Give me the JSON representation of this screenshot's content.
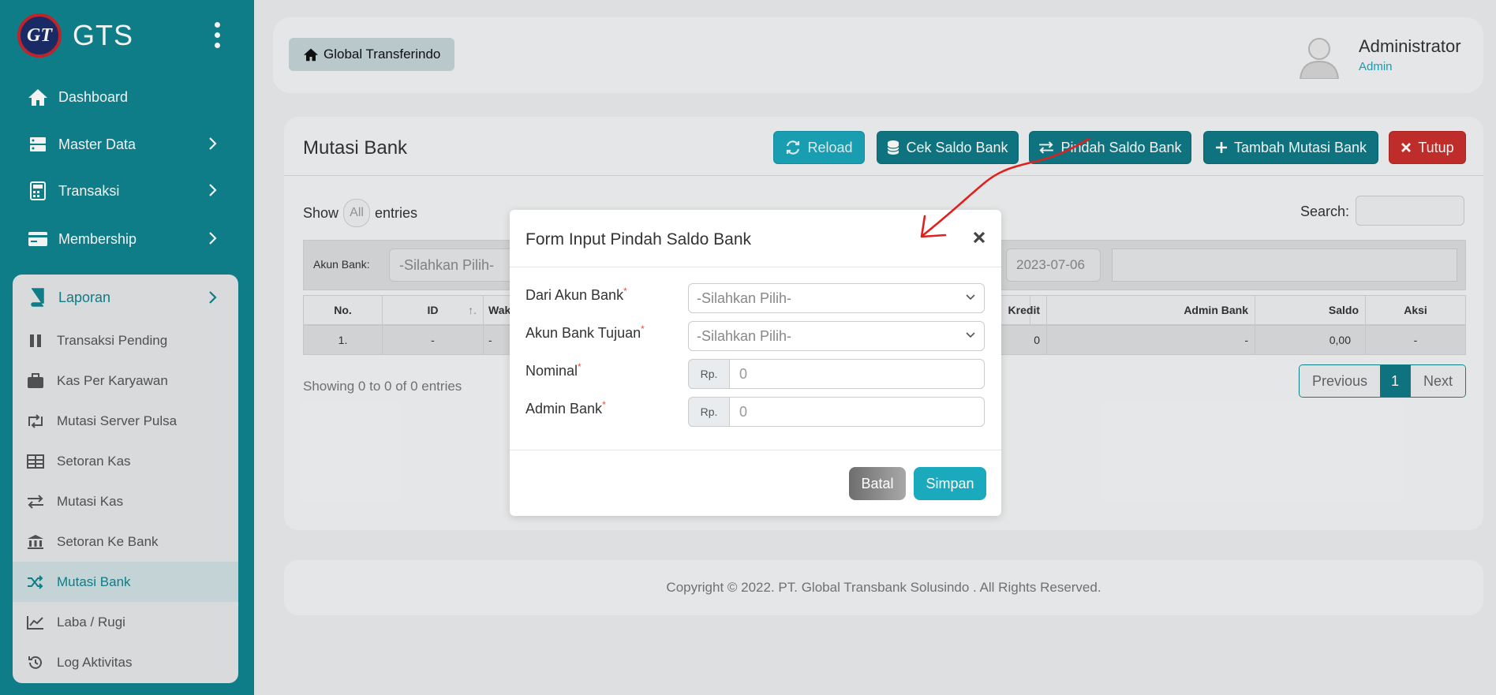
{
  "sidebar": {
    "brand": "GTS",
    "logo_text": "GT",
    "menu": [
      {
        "label": "Dashboard",
        "icon": "home-icon"
      },
      {
        "label": "Master Data",
        "icon": "server-icon"
      },
      {
        "label": "Transaksi",
        "icon": "calculator-icon"
      },
      {
        "label": "Membership",
        "icon": "card-icon"
      }
    ],
    "laporan": {
      "label": "Laporan",
      "icon": "book-icon",
      "items": [
        {
          "label": "Transaksi Pending",
          "icon": "pause-icon"
        },
        {
          "label": "Kas Per Karyawan",
          "icon": "briefcase-icon"
        },
        {
          "label": "Mutasi Server Pulsa",
          "icon": "retweet-icon"
        },
        {
          "label": "Setoran Kas",
          "icon": "table-icon"
        },
        {
          "label": "Mutasi Kas",
          "icon": "exchange-icon"
        },
        {
          "label": "Setoran Ke Bank",
          "icon": "bank-icon"
        },
        {
          "label": "Mutasi Bank",
          "icon": "shuffle-icon",
          "active": true
        },
        {
          "label": "Laba / Rugi",
          "icon": "line-chart-icon"
        },
        {
          "label": "Log Aktivitas",
          "icon": "history-icon"
        }
      ]
    }
  },
  "header": {
    "breadcrumb": "Global Transferindo",
    "user_name": "Administrator",
    "user_role": "Admin"
  },
  "page": {
    "title": "Mutasi Bank",
    "buttons": {
      "reload": "Reload",
      "cek_saldo": "Cek Saldo Bank",
      "pindah_saldo": "Pindah Saldo Bank",
      "tambah_mutasi": "Tambah Mutasi Bank",
      "tutup": "Tutup"
    },
    "show": "Show",
    "show_value": "All",
    "entries": "entries",
    "search_label": "Search:",
    "filter_label": "Akun Bank:",
    "filter_placeholder": "-Silahkan Pilih-",
    "filter_date": "2023-07-06",
    "table": {
      "headers": [
        "No.",
        "ID",
        "Wak",
        "Kredit",
        "Admin Bank",
        "Saldo",
        "Aksi"
      ],
      "sort_icon": "↑.",
      "row": [
        "1.",
        "-",
        "-",
        "0",
        "-",
        "0,00",
        "-"
      ]
    },
    "showing": "Showing 0 to 0 of 0 entries",
    "pagination": {
      "previous": "Previous",
      "current": "1",
      "next": "Next"
    }
  },
  "footer": {
    "text": "Copyright © 2022. PT. Global Transbank Solusindo . All Rights Reserved."
  },
  "modal": {
    "title": "Form Input Pindah Saldo Bank",
    "required_mark": "*",
    "fields": {
      "dari_akun": {
        "label": "Dari Akun Bank",
        "placeholder": "-Silahkan Pilih-"
      },
      "akun_tujuan": {
        "label": "Akun Bank Tujuan",
        "placeholder": "-Silahkan Pilih-"
      },
      "nominal": {
        "label": "Nominal",
        "addon": "Rp.",
        "placeholder": "0"
      },
      "admin_bank": {
        "label": "Admin Bank",
        "addon": "Rp.",
        "placeholder": "0"
      }
    },
    "batal": "Batal",
    "simpan": "Simpan"
  },
  "colors": {
    "sidebar_bg": "#0f848f",
    "accent": "#1aa9bd",
    "danger": "#c9302c",
    "annotation": "#e0201f"
  }
}
